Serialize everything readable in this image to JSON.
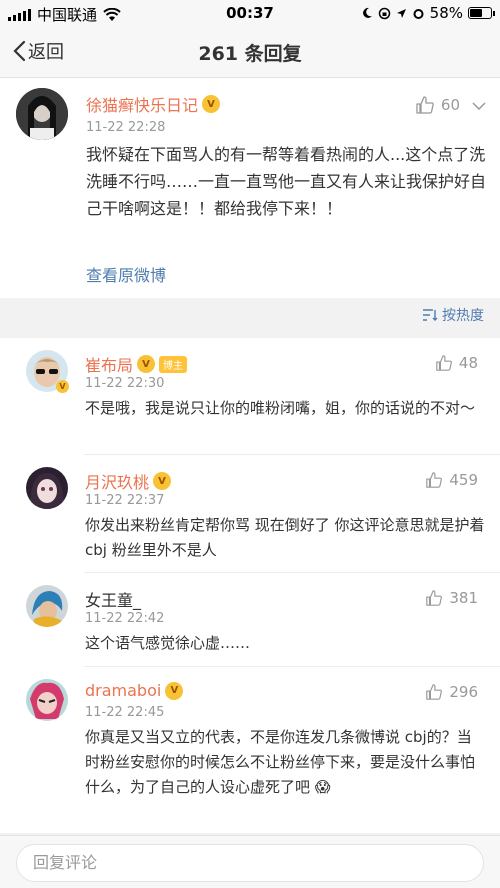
{
  "status_bar": {
    "carrier": "中国联通",
    "time": "00:37",
    "battery": "58%"
  },
  "nav": {
    "back_label": "返回",
    "title": "261 条回复"
  },
  "main_post": {
    "username": "徐猫癣快乐日记",
    "time": "11-22 22:28",
    "likes": "60",
    "text": "我怀疑在下面骂人的有一帮等着看热闹的人...这个点了洗洗睡不行吗……一直一直骂他一直又有人来让我保护好自己干啥啊这是！！都给我停下来！！",
    "link_label": "查看原微博"
  },
  "sort": {
    "label": "按热度"
  },
  "comments": [
    {
      "username": "崔布局",
      "badge": "博主",
      "time": "11-22 22:30",
      "likes": "48",
      "text": "不是哦，我是说只让你的唯粉闭嘴，姐，你的话说的不对～"
    },
    {
      "username": "月沢玖桃",
      "time": "11-22 22:37",
      "likes": "459",
      "text": "你发出来粉丝肯定帮你骂 现在倒好了 你这评论意思就是护着 cbj  粉丝里外不是人"
    },
    {
      "username": "女王童_",
      "time": "11-22 22:42",
      "likes": "381",
      "text": "这个语气感觉徐心虚……"
    },
    {
      "username": "dramaboi",
      "time": "11-22 22:45",
      "likes": "296",
      "text": "你真是又当又立的代表，不是你连发几条微博说 cbj的？当时粉丝安慰你的时候怎么不让粉丝停下来，要是没什么事怕什么，为了自己的人设心虚死了吧 😱"
    }
  ],
  "reply_bar": {
    "placeholder": "回复评论"
  },
  "colors": {
    "username_orange": "#eb7350",
    "link_blue": "#507daf",
    "meta_gray": "#999999"
  }
}
